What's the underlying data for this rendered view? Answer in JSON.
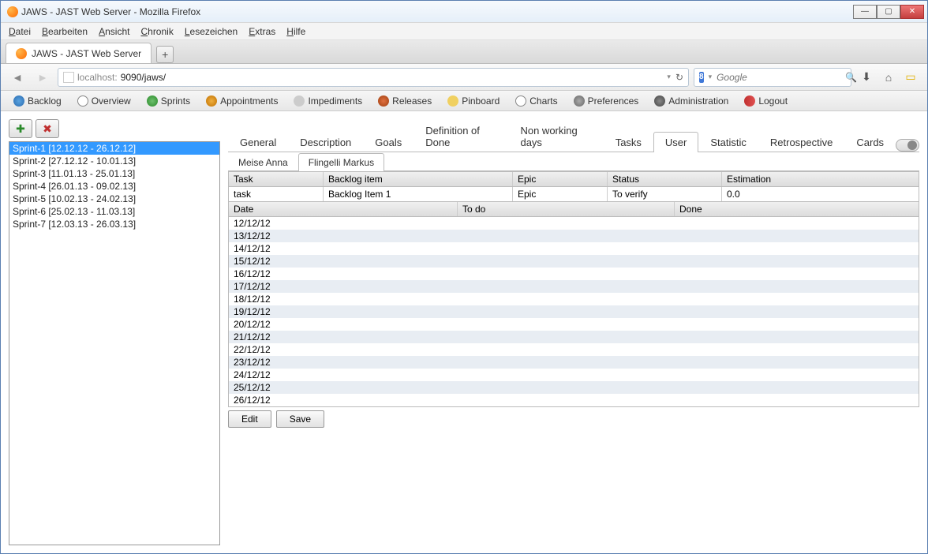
{
  "window": {
    "title": "JAWS - JAST Web Server - Mozilla Firefox"
  },
  "menubar": [
    "Datei",
    "Bearbeiten",
    "Ansicht",
    "Chronik",
    "Lesezeichen",
    "Extras",
    "Hilfe"
  ],
  "browser_tab": "JAWS - JAST Web Server",
  "url": {
    "host": "localhost:",
    "path": "9090/jaws/"
  },
  "search": {
    "placeholder": "Google"
  },
  "toolbar": [
    {
      "id": "backlog",
      "label": "Backlog"
    },
    {
      "id": "overview",
      "label": "Overview"
    },
    {
      "id": "sprints",
      "label": "Sprints"
    },
    {
      "id": "appointments",
      "label": "Appointments"
    },
    {
      "id": "impediments",
      "label": "Impediments"
    },
    {
      "id": "releases",
      "label": "Releases"
    },
    {
      "id": "pinboard",
      "label": "Pinboard"
    },
    {
      "id": "charts",
      "label": "Charts"
    },
    {
      "id": "preferences",
      "label": "Preferences"
    },
    {
      "id": "administration",
      "label": "Administration"
    },
    {
      "id": "logout",
      "label": "Logout"
    }
  ],
  "sprints": [
    "Sprint-1 [12.12.12 - 26.12.12]",
    "Sprint-2 [27.12.12 - 10.01.13]",
    "Sprint-3 [11.01.13 - 25.01.13]",
    "Sprint-4 [26.01.13 - 09.02.13]",
    "Sprint-5 [10.02.13 - 24.02.13]",
    "Sprint-6 [25.02.13 - 11.03.13]",
    "Sprint-7 [12.03.13 - 26.03.13]"
  ],
  "tabs_main": [
    "General",
    "Description",
    "Goals",
    "Definition of Done",
    "Non working days",
    "Tasks",
    "User",
    "Statistic",
    "Retrospective",
    "Cards"
  ],
  "tabs_main_active": "User",
  "tabs_user": [
    "Meise Anna",
    "Flingelli Markus"
  ],
  "tabs_user_active": "Flingelli Markus",
  "task_header": {
    "task": "Task",
    "backlog": "Backlog item",
    "epic": "Epic",
    "status": "Status",
    "est": "Estimation"
  },
  "task_row": {
    "task": "task",
    "backlog": "Backlog Item 1",
    "epic": "Epic",
    "status": "To verify",
    "est": "0.0"
  },
  "date_header": {
    "date": "Date",
    "todo": "To do",
    "done": "Done"
  },
  "dates": [
    "12/12/12",
    "13/12/12",
    "14/12/12",
    "15/12/12",
    "16/12/12",
    "17/12/12",
    "18/12/12",
    "19/12/12",
    "20/12/12",
    "21/12/12",
    "22/12/12",
    "23/12/12",
    "24/12/12",
    "25/12/12",
    "26/12/12"
  ],
  "buttons": {
    "edit": "Edit",
    "save": "Save"
  }
}
